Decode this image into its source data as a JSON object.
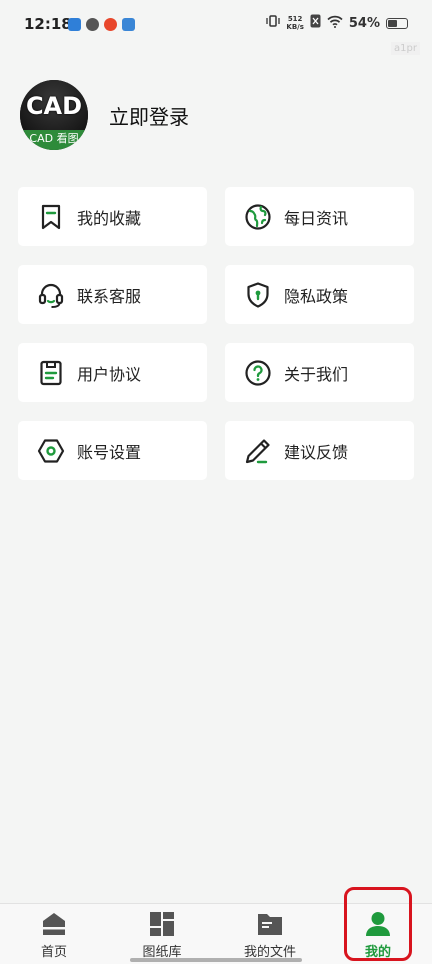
{
  "status_bar": {
    "time": "12:18",
    "net_speed_value": "512",
    "net_speed_unit": "KB/s",
    "battery": "54%",
    "battery_level": 0.54
  },
  "watermark": "a1pr",
  "profile": {
    "avatar_logo_text": "CAD",
    "avatar_caption": "CAD 看图",
    "login_label": "立即登录"
  },
  "menu": {
    "items": [
      {
        "label": "我的收藏",
        "icon": "bookmark-icon"
      },
      {
        "label": "每日资讯",
        "icon": "globe-icon"
      },
      {
        "label": "联系客服",
        "icon": "headset-icon"
      },
      {
        "label": "隐私政策",
        "icon": "shield-lock-icon"
      },
      {
        "label": "用户协议",
        "icon": "document-icon"
      },
      {
        "label": "关于我们",
        "icon": "question-circle-icon"
      },
      {
        "label": "账号设置",
        "icon": "hexagon-settings-icon"
      },
      {
        "label": "建议反馈",
        "icon": "pencil-icon"
      }
    ]
  },
  "bottom_nav": {
    "items": [
      {
        "label": "首页",
        "icon": "home-icon"
      },
      {
        "label": "图纸库",
        "icon": "layout-grid-icon"
      },
      {
        "label": "我的文件",
        "icon": "folder-icon"
      },
      {
        "label": "我的",
        "icon": "user-icon"
      }
    ],
    "active_index": 3,
    "active_color": "#1f9a3d"
  },
  "colors": {
    "accent_green": "#1f9a3d",
    "highlight_red": "#d8141e",
    "background": "#f4f5f4"
  }
}
